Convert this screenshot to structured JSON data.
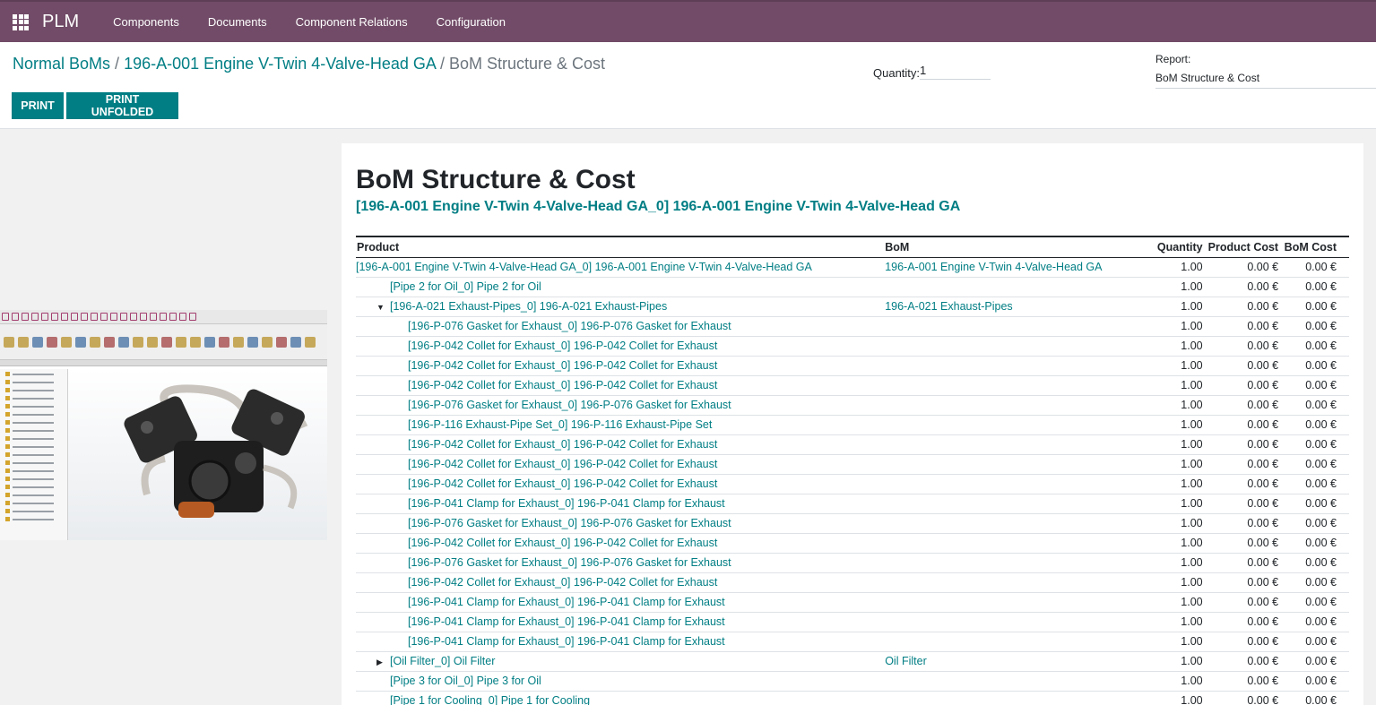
{
  "nav": {
    "app_name": "PLM",
    "menu": [
      "Components",
      "Documents",
      "Component Relations",
      "Configuration"
    ]
  },
  "breadcrumb": {
    "items": [
      "Normal BoMs",
      "196-A-001 Engine V-Twin 4-Valve-Head GA"
    ],
    "separator": "/",
    "current": "BoM Structure & Cost"
  },
  "quantity": {
    "label": "Quantity:",
    "value": "1"
  },
  "report_select": {
    "label": "Report:",
    "value": "BoM Structure & Cost"
  },
  "buttons": {
    "print": "PRINT",
    "print_unfolded": "PRINT UNFOLDED"
  },
  "report": {
    "title": "BoM Structure & Cost",
    "subtitle": "[196-A-001 Engine V-Twin 4-Valve-Head GA_0] 196-A-001 Engine V-Twin 4-Valve-Head GA",
    "columns": {
      "product": "Product",
      "bom": "BoM",
      "quantity": "Quantity",
      "product_cost": "Product Cost",
      "bom_cost": "BoM Cost"
    },
    "rows": [
      {
        "product": "[196-A-001 Engine V-Twin 4-Valve-Head GA_0] 196-A-001 Engine V-Twin 4-Valve-Head GA",
        "bom": "196-A-001 Engine V-Twin 4-Valve-Head GA",
        "qty": "1.00",
        "pcost": "0.00 €",
        "bcost": "0.00 €",
        "level": 0,
        "caret": ""
      },
      {
        "product": "[Pipe 2 for Oil_0] Pipe 2 for Oil",
        "bom": "",
        "qty": "1.00",
        "pcost": "0.00 €",
        "bcost": "0.00 €",
        "level": 1,
        "caret": ""
      },
      {
        "product": "[196-A-021 Exhaust-Pipes_0] 196-A-021 Exhaust-Pipes",
        "bom": "196-A-021 Exhaust-Pipes",
        "qty": "1.00",
        "pcost": "0.00 €",
        "bcost": "0.00 €",
        "level": 1,
        "caret": "▼"
      },
      {
        "product": "[196-P-076 Gasket for Exhaust_0] 196-P-076 Gasket for Exhaust",
        "bom": "",
        "qty": "1.00",
        "pcost": "0.00 €",
        "bcost": "0.00 €",
        "level": 2,
        "caret": ""
      },
      {
        "product": "[196-P-042 Collet for Exhaust_0] 196-P-042 Collet for Exhaust",
        "bom": "",
        "qty": "1.00",
        "pcost": "0.00 €",
        "bcost": "0.00 €",
        "level": 2,
        "caret": ""
      },
      {
        "product": "[196-P-042 Collet for Exhaust_0] 196-P-042 Collet for Exhaust",
        "bom": "",
        "qty": "1.00",
        "pcost": "0.00 €",
        "bcost": "0.00 €",
        "level": 2,
        "caret": ""
      },
      {
        "product": "[196-P-042 Collet for Exhaust_0] 196-P-042 Collet for Exhaust",
        "bom": "",
        "qty": "1.00",
        "pcost": "0.00 €",
        "bcost": "0.00 €",
        "level": 2,
        "caret": ""
      },
      {
        "product": "[196-P-076 Gasket for Exhaust_0] 196-P-076 Gasket for Exhaust",
        "bom": "",
        "qty": "1.00",
        "pcost": "0.00 €",
        "bcost": "0.00 €",
        "level": 2,
        "caret": ""
      },
      {
        "product": "[196-P-116 Exhaust-Pipe Set_0] 196-P-116 Exhaust-Pipe Set",
        "bom": "",
        "qty": "1.00",
        "pcost": "0.00 €",
        "bcost": "0.00 €",
        "level": 2,
        "caret": ""
      },
      {
        "product": "[196-P-042 Collet for Exhaust_0] 196-P-042 Collet for Exhaust",
        "bom": "",
        "qty": "1.00",
        "pcost": "0.00 €",
        "bcost": "0.00 €",
        "level": 2,
        "caret": ""
      },
      {
        "product": "[196-P-042 Collet for Exhaust_0] 196-P-042 Collet for Exhaust",
        "bom": "",
        "qty": "1.00",
        "pcost": "0.00 €",
        "bcost": "0.00 €",
        "level": 2,
        "caret": ""
      },
      {
        "product": "[196-P-042 Collet for Exhaust_0] 196-P-042 Collet for Exhaust",
        "bom": "",
        "qty": "1.00",
        "pcost": "0.00 €",
        "bcost": "0.00 €",
        "level": 2,
        "caret": ""
      },
      {
        "product": "[196-P-041 Clamp for Exhaust_0] 196-P-041 Clamp for Exhaust",
        "bom": "",
        "qty": "1.00",
        "pcost": "0.00 €",
        "bcost": "0.00 €",
        "level": 2,
        "caret": ""
      },
      {
        "product": "[196-P-076 Gasket for Exhaust_0] 196-P-076 Gasket for Exhaust",
        "bom": "",
        "qty": "1.00",
        "pcost": "0.00 €",
        "bcost": "0.00 €",
        "level": 2,
        "caret": ""
      },
      {
        "product": "[196-P-042 Collet for Exhaust_0] 196-P-042 Collet for Exhaust",
        "bom": "",
        "qty": "1.00",
        "pcost": "0.00 €",
        "bcost": "0.00 €",
        "level": 2,
        "caret": ""
      },
      {
        "product": "[196-P-076 Gasket for Exhaust_0] 196-P-076 Gasket for Exhaust",
        "bom": "",
        "qty": "1.00",
        "pcost": "0.00 €",
        "bcost": "0.00 €",
        "level": 2,
        "caret": ""
      },
      {
        "product": "[196-P-042 Collet for Exhaust_0] 196-P-042 Collet for Exhaust",
        "bom": "",
        "qty": "1.00",
        "pcost": "0.00 €",
        "bcost": "0.00 €",
        "level": 2,
        "caret": ""
      },
      {
        "product": "[196-P-041 Clamp for Exhaust_0] 196-P-041 Clamp for Exhaust",
        "bom": "",
        "qty": "1.00",
        "pcost": "0.00 €",
        "bcost": "0.00 €",
        "level": 2,
        "caret": ""
      },
      {
        "product": "[196-P-041 Clamp for Exhaust_0] 196-P-041 Clamp for Exhaust",
        "bom": "",
        "qty": "1.00",
        "pcost": "0.00 €",
        "bcost": "0.00 €",
        "level": 2,
        "caret": ""
      },
      {
        "product": "[196-P-041 Clamp for Exhaust_0] 196-P-041 Clamp for Exhaust",
        "bom": "",
        "qty": "1.00",
        "pcost": "0.00 €",
        "bcost": "0.00 €",
        "level": 2,
        "caret": ""
      },
      {
        "product": "[Oil Filter_0] Oil Filter",
        "bom": "Oil Filter",
        "qty": "1.00",
        "pcost": "0.00 €",
        "bcost": "0.00 €",
        "level": 1,
        "caret": "▶"
      },
      {
        "product": "[Pipe 3 for Oil_0] Pipe 3 for Oil",
        "bom": "",
        "qty": "1.00",
        "pcost": "0.00 €",
        "bcost": "0.00 €",
        "level": 1,
        "caret": ""
      },
      {
        "product": "[Pipe 1 for Cooling_0] Pipe 1 for Cooling",
        "bom": "",
        "qty": "1.00",
        "pcost": "0.00 €",
        "bcost": "0.00 €",
        "level": 1,
        "caret": ""
      }
    ]
  },
  "colors": {
    "navbar": "#714b67",
    "accent": "#017e84"
  },
  "icons": {
    "apps": "grid-icon",
    "expanded": "caret-down-icon",
    "collapsed": "caret-right-icon"
  }
}
